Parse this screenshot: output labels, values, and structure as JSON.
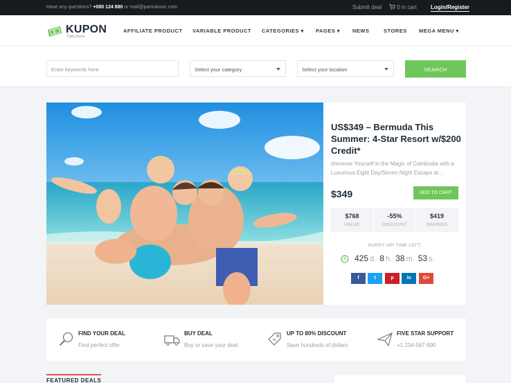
{
  "topbar": {
    "question": "Have any questions?",
    "phone": "+080 124 880",
    "or_text": "or",
    "email": "mail@pamukovic.com",
    "submit_deal": "Submit deal",
    "cart": "0 in cart",
    "login": "Login/Register"
  },
  "header": {
    "logo_name": "KUPON",
    "logo_tagline": "Daily Deals",
    "nav": [
      {
        "label": "AFFILIATE PRODUCT"
      },
      {
        "label": "VARIABLE PRODUCT"
      },
      {
        "label": "CATEGORIES ▾"
      },
      {
        "label": "PAGES ▾"
      },
      {
        "label": "NEWS"
      },
      {
        "label": "STORES"
      },
      {
        "label": "MEGA MENU ▾"
      }
    ]
  },
  "search": {
    "keywords_placeholder": "Enter keywords here",
    "category": "Select your category",
    "location": "Select your location",
    "button": "SEARCH"
  },
  "deal": {
    "title": "US$349 – Bermuda This Summer: 4-Star Resort w/$200 Credit*",
    "description": "Immerse Yourself in the Magic of Cambodia with a Luxurious Eight Day/Seven Night Escape at...",
    "price": "$349",
    "add_to_cart": "ADD TO CART",
    "stats": [
      {
        "value": "$768",
        "label": "VALUE"
      },
      {
        "value": "-55%",
        "label": "DISCOUNT"
      },
      {
        "value": "$419",
        "label": "SAVINGS"
      }
    ],
    "hurry": "HURRY UP! TIME LEFT:",
    "timer": {
      "days": "425",
      "d": "d.",
      "hours": "8",
      "h": "h.",
      "minutes": "38",
      "m": "m.",
      "seconds": "53",
      "s": "s."
    },
    "share": [
      {
        "label": "f",
        "color": "#3b5998"
      },
      {
        "label": "t",
        "color": "#1da1f2"
      },
      {
        "label": "p",
        "color": "#cb2027"
      },
      {
        "label": "in",
        "color": "#0077b5"
      },
      {
        "label": "G+",
        "color": "#dd4b39"
      }
    ]
  },
  "features": [
    {
      "title": "FIND YOUR DEAL",
      "subtitle": "Find perfect offer",
      "icon": "search-icon"
    },
    {
      "title": "BUY DEAL",
      "subtitle": "Buy or save your deal",
      "icon": "truck-icon"
    },
    {
      "title": "UP TO 80% DISCOUNT",
      "subtitle": "Save hundreds of dollars",
      "icon": "tag-icon"
    },
    {
      "title": "FIVE STAR SUPPORT",
      "subtitle": "+1 234-567-890",
      "icon": "paper-plane-icon"
    }
  ],
  "featured_heading": "FEATURED DEALS",
  "colors": {
    "accent_green": "#6fc65a",
    "topbar": "#171a1f",
    "heading": "#1e2a35"
  }
}
